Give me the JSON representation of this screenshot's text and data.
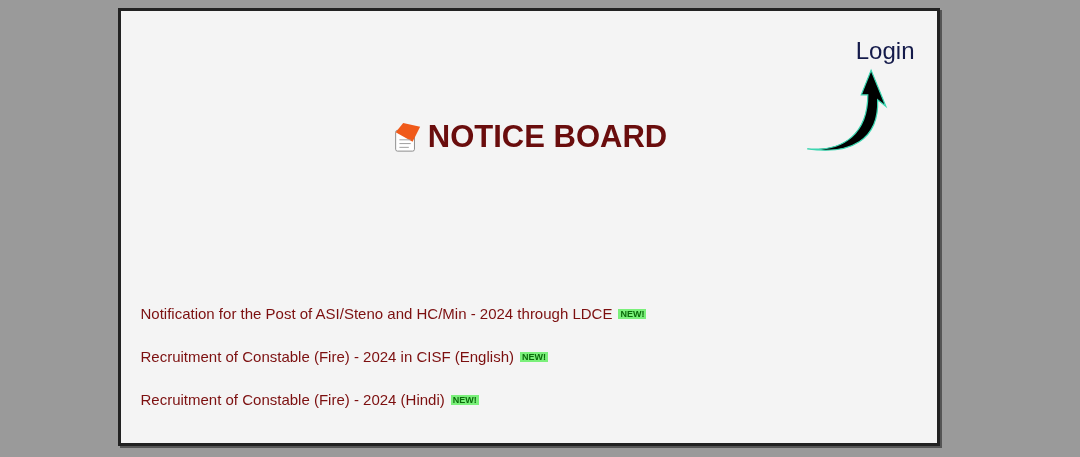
{
  "login": "Login",
  "title": "NOTICE BOARD",
  "notices": [
    {
      "text": "Notification for the Post of ASI/Steno and HC/Min - 2024 through LDCE",
      "badge": "NEW!"
    },
    {
      "text": "Recruitment of Constable (Fire) - 2024 in CISF (English)",
      "badge": "NEW!"
    },
    {
      "text": "Recruitment of Constable (Fire) - 2024 (Hindi)",
      "badge": "NEW!"
    }
  ]
}
